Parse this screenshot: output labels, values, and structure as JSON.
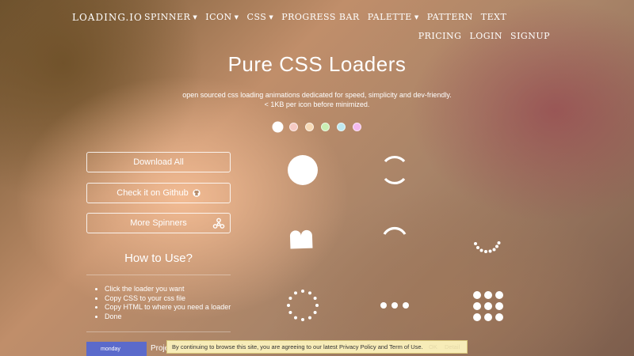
{
  "nav": {
    "brand": "LOADING.IO",
    "items": [
      {
        "label": "SPINNER",
        "caret": true
      },
      {
        "label": "ICON",
        "caret": true
      },
      {
        "label": "CSS",
        "caret": true
      },
      {
        "label": "PROGRESS BAR",
        "caret": false
      },
      {
        "label": "PALETTE",
        "caret": true
      },
      {
        "label": "PATTERN",
        "caret": false
      },
      {
        "label": "TEXT",
        "caret": false
      }
    ],
    "right_items": [
      "PRICING",
      "LOGIN",
      "SIGNUP"
    ]
  },
  "hero": {
    "title": "Pure CSS Loaders",
    "subtitle_line1": "open sourced css loading animations dedicated for speed, simplicity and dev-friendly.",
    "subtitle_line2": "< 1KB per icon before minimized."
  },
  "palette_dots": [
    "#ffffff",
    "#f6c9c3",
    "#f6d9b6",
    "#c9efb3",
    "#bfe9f0",
    "#f3b9ee"
  ],
  "buttons": {
    "download_all": "Download All",
    "github": "Check it on Github",
    "more_spinners": "More Spinners"
  },
  "howto": {
    "title": "How to Use?",
    "steps": [
      "Click the loader you want",
      "Copy CSS to your css file",
      "Copy HTML to where you need a loader",
      "Done"
    ]
  },
  "ad": {
    "brand": "monday",
    "text": "Proje"
  },
  "cookie": {
    "text": "By continuing to browse this site, you are agreeing to our latest Privacy Policy and Term of Use.",
    "ok": "OK",
    "detail": "Detail"
  },
  "loaders": [
    "circle",
    "dual-ring",
    "heart",
    "ring",
    "roller",
    "default",
    "ellipsis",
    "grid"
  ]
}
